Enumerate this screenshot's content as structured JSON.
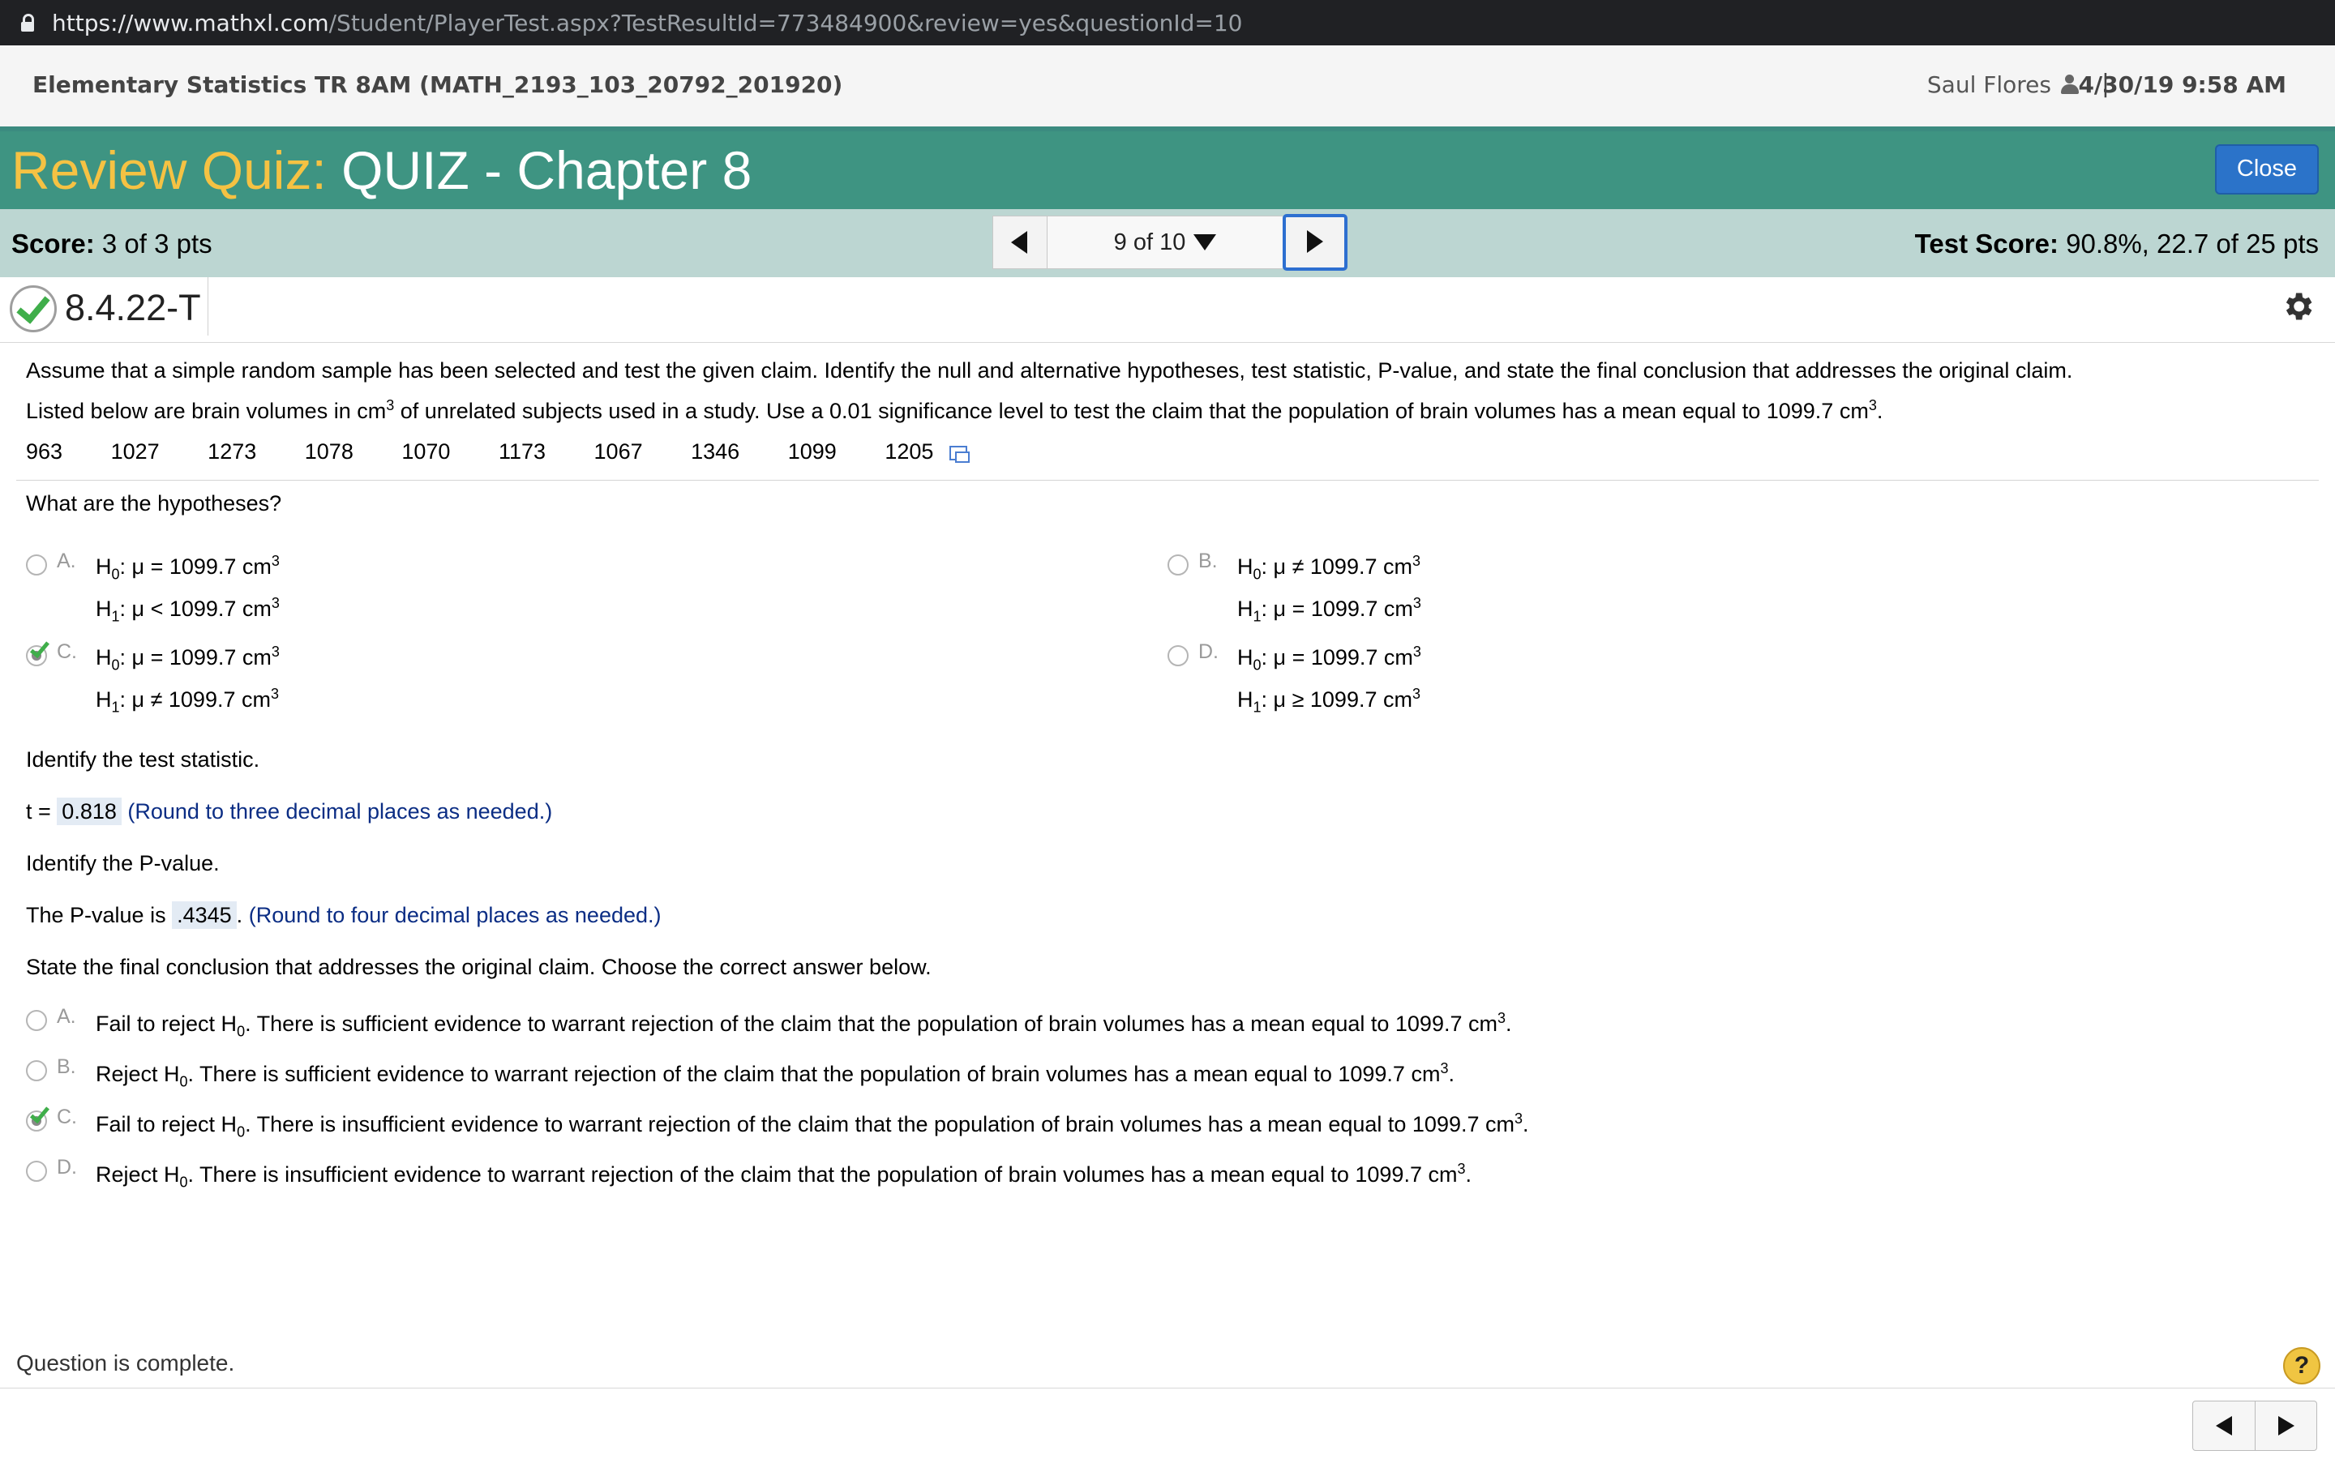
{
  "browser": {
    "url_host": "https://www.mathxl.com",
    "url_path": "/Student/PlayerTest.aspx?TestResultId=773484900&review=yes&questionId=10"
  },
  "course": {
    "title": "Elementary Statistics TR 8AM (MATH_2193_103_20792_201920)",
    "user": "Saul Flores",
    "separator": "|",
    "datetime": "4/30/19 9:58 AM"
  },
  "quiz": {
    "review_label": "Review Quiz:",
    "name": "QUIZ - Chapter 8",
    "close_label": "Close"
  },
  "score": {
    "label": "Score:",
    "value": "3 of 3 pts",
    "question_position": "9 of 10",
    "test_label": "Test Score:",
    "test_value": "90.8%, 22.7 of 25 pts"
  },
  "question": {
    "id": "8.4.22-T",
    "intro": "Assume that a simple random sample has been selected and test the given claim. Identify the null and alternative hypotheses, test statistic, P-value, and state the final conclusion that addresses the original claim.",
    "stmt_a": "Listed below are brain volumes in cm",
    "stmt_b": " of unrelated subjects used in a study. Use a 0.01 significance level to test the claim that the population of brain volumes has a mean equal to 1099.7 cm",
    "stmt_end": ".",
    "exp": "3",
    "data": [
      "963",
      "1027",
      "1273",
      "1078",
      "1070",
      "1173",
      "1067",
      "1346",
      "1099",
      "1205"
    ],
    "hyp_prompt": "What are the hypotheses?",
    "hypotheses": [
      {
        "letter": "A.",
        "h0": "H",
        "h0sub": "0",
        "h0rel": ": μ = 1099.7 cm",
        "h1": "H",
        "h1sub": "1",
        "h1rel": ": μ < 1099.7 cm",
        "selected": false
      },
      {
        "letter": "B.",
        "h0": "H",
        "h0sub": "0",
        "h0rel": ": μ ≠ 1099.7 cm",
        "h1": "H",
        "h1sub": "1",
        "h1rel": ": μ = 1099.7 cm",
        "selected": false
      },
      {
        "letter": "C.",
        "h0": "H",
        "h0sub": "0",
        "h0rel": ": μ = 1099.7 cm",
        "h1": "H",
        "h1sub": "1",
        "h1rel": ": μ ≠ 1099.7 cm",
        "selected": true
      },
      {
        "letter": "D.",
        "h0": "H",
        "h0sub": "0",
        "h0rel": ": μ = 1099.7 cm",
        "h1": "H",
        "h1sub": "1",
        "h1rel": ": μ ≥ 1099.7 cm",
        "selected": false
      }
    ],
    "ts_prompt": "Identify the test statistic.",
    "ts_label": "t =",
    "ts_value": "0.818",
    "ts_hint": "(Round to three decimal places as needed.)",
    "pv_prompt": "Identify the P-value.",
    "pv_label": "The P-value is",
    "pv_value": ".4345",
    "pv_after": ".",
    "pv_hint": "(Round to four decimal places as needed.)",
    "concl_prompt": "State the final conclusion that addresses the original claim. Choose the correct answer below.",
    "conclusions": [
      {
        "letter": "A.",
        "pre": "Fail to reject H",
        "sub": "0",
        "post": ". There is sufficient evidence to warrant rejection of the claim that the population of brain volumes has a mean equal to 1099.7 cm",
        "selected": false
      },
      {
        "letter": "B.",
        "pre": "Reject H",
        "sub": "0",
        "post": ". There is sufficient evidence to warrant rejection of the claim that the population of brain volumes has a mean equal to 1099.7 cm",
        "selected": false
      },
      {
        "letter": "C.",
        "pre": "Fail to reject H",
        "sub": "0",
        "post": ". There is insufficient evidence to warrant rejection of the claim that the population of brain volumes has a mean equal to 1099.7 cm",
        "selected": true
      },
      {
        "letter": "D.",
        "pre": "Reject H",
        "sub": "0",
        "post": ". There is insufficient evidence to warrant rejection of the claim that the population of brain volumes has a mean equal to 1099.7 cm",
        "selected": false
      }
    ]
  },
  "footer": {
    "status": "Question is complete.",
    "help": "?"
  },
  "colors": {
    "quiz_bar": "#3e9482",
    "score_bar": "#bcd6d2",
    "review_label": "#f5c243",
    "close_button": "#2b73c9",
    "check_green": "#3fae4a",
    "hint_text": "#0b2d84"
  },
  "icons": [
    "lock-icon",
    "person-icon",
    "chevron-left-icon",
    "chevron-right-icon",
    "caret-down-icon",
    "check-icon",
    "gear-icon",
    "copy-data-icon",
    "help-icon"
  ]
}
